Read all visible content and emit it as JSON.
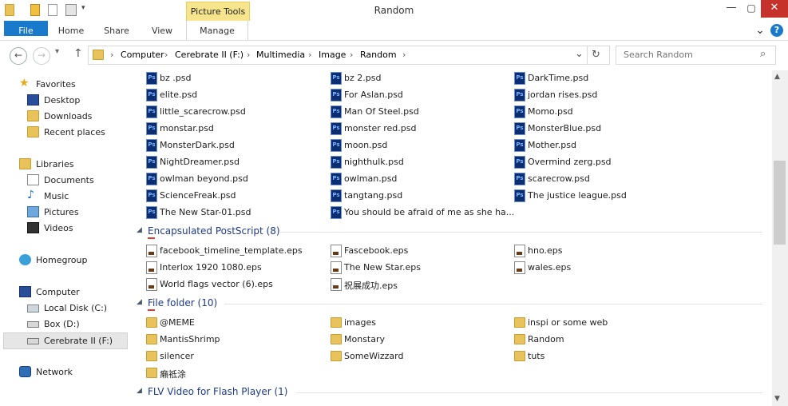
{
  "window": {
    "title": "Random",
    "contextual_tab": "Picture Tools",
    "controls": {
      "minimize": "—",
      "maximize": "▢",
      "close": "✕"
    }
  },
  "ribbon": {
    "tabs": [
      "File",
      "Home",
      "Share",
      "View",
      "Manage"
    ],
    "collapse_glyph": "⌄",
    "help_glyph": "?"
  },
  "address": {
    "back_glyph": "←",
    "forward_glyph": "→",
    "up_glyph": "↑",
    "breadcrumbs": [
      "Computer",
      "Cerebrate II (F:)",
      "Multimedia",
      "Image",
      "Random"
    ],
    "separator": "›",
    "dropdown_glyph": "⌄",
    "refresh_glyph": "↻"
  },
  "search": {
    "placeholder": "Search Random",
    "icon_glyph": "⌕"
  },
  "nav": [
    {
      "label": "Favorites",
      "icon": "star-icon"
    },
    {
      "label": "Desktop",
      "icon": "desktop-icon"
    },
    {
      "label": "Downloads",
      "icon": "downloads-icon"
    },
    {
      "label": "Recent places",
      "icon": "recent-places-icon"
    },
    {
      "label": "Libraries",
      "icon": "libraries-icon"
    },
    {
      "label": "Documents",
      "icon": "documents-icon"
    },
    {
      "label": "Music",
      "icon": "music-icon"
    },
    {
      "label": "Pictures",
      "icon": "pictures-icon"
    },
    {
      "label": "Videos",
      "icon": "videos-icon"
    },
    {
      "label": "Homegroup",
      "icon": "homegroup-icon"
    },
    {
      "label": "Computer",
      "icon": "computer-icon"
    },
    {
      "label": "Local Disk (C:)",
      "icon": "local-disk-icon"
    },
    {
      "label": "Box (D:)",
      "icon": "drive-icon"
    },
    {
      "label": "Cerebrate II (F:)",
      "icon": "drive-icon",
      "selected": true
    },
    {
      "label": "Network",
      "icon": "network-icon"
    }
  ],
  "psd_files": [
    "bz .psd",
    "bz 2.psd",
    "DarkTime.psd",
    "elite.psd",
    "For Aslan.psd",
    "jordan rises.psd",
    "little_scarecrow.psd",
    "Man Of Steel.psd",
    "Momo.psd",
    "monstar.psd",
    "monster red.psd",
    "MonsterBlue.psd",
    "MonsterDark.psd",
    "moon.psd",
    "Mother.psd",
    "NightDreamer.psd",
    "nighthulk.psd",
    "Overmind zerg.psd",
    "owlman beyond.psd",
    "owlman.psd",
    "scarecrow.psd",
    "ScienceFreak.psd",
    "tangtang.psd",
    "The justice league.psd",
    "The New Star-01.psd",
    "You should be afraid of me as she ha..."
  ],
  "groups": {
    "eps": {
      "title": "Encapsulated PostScript (8)",
      "collapse_glyph": "◢"
    },
    "folders": {
      "title": "File folder (10)",
      "collapse_glyph": "◢"
    },
    "flv": {
      "title": "FLV Video for Flash Player (1)",
      "collapse_glyph": "◢"
    }
  },
  "eps_files": [
    "facebook_timeline_template.eps",
    "Fascebook.eps",
    "hno.eps",
    "Interlox 1920 1080.eps",
    "The New Star.eps",
    "wales.eps",
    "World flags vector (6).eps",
    "祝展成功.eps"
  ],
  "folders": [
    "@MEME",
    "images",
    "inspi or some web",
    "MantisShrimp",
    "Monstary",
    "Random",
    "silencer",
    "SomeWizzard",
    "tuts",
    "癩祗涂"
  ],
  "file_icons": {
    "psd": "photoshop-file-icon",
    "eps": "eps-file-icon",
    "folder": "folder-icon"
  },
  "scrollbar": {
    "up_glyph": "▲",
    "down_glyph": "▼"
  }
}
